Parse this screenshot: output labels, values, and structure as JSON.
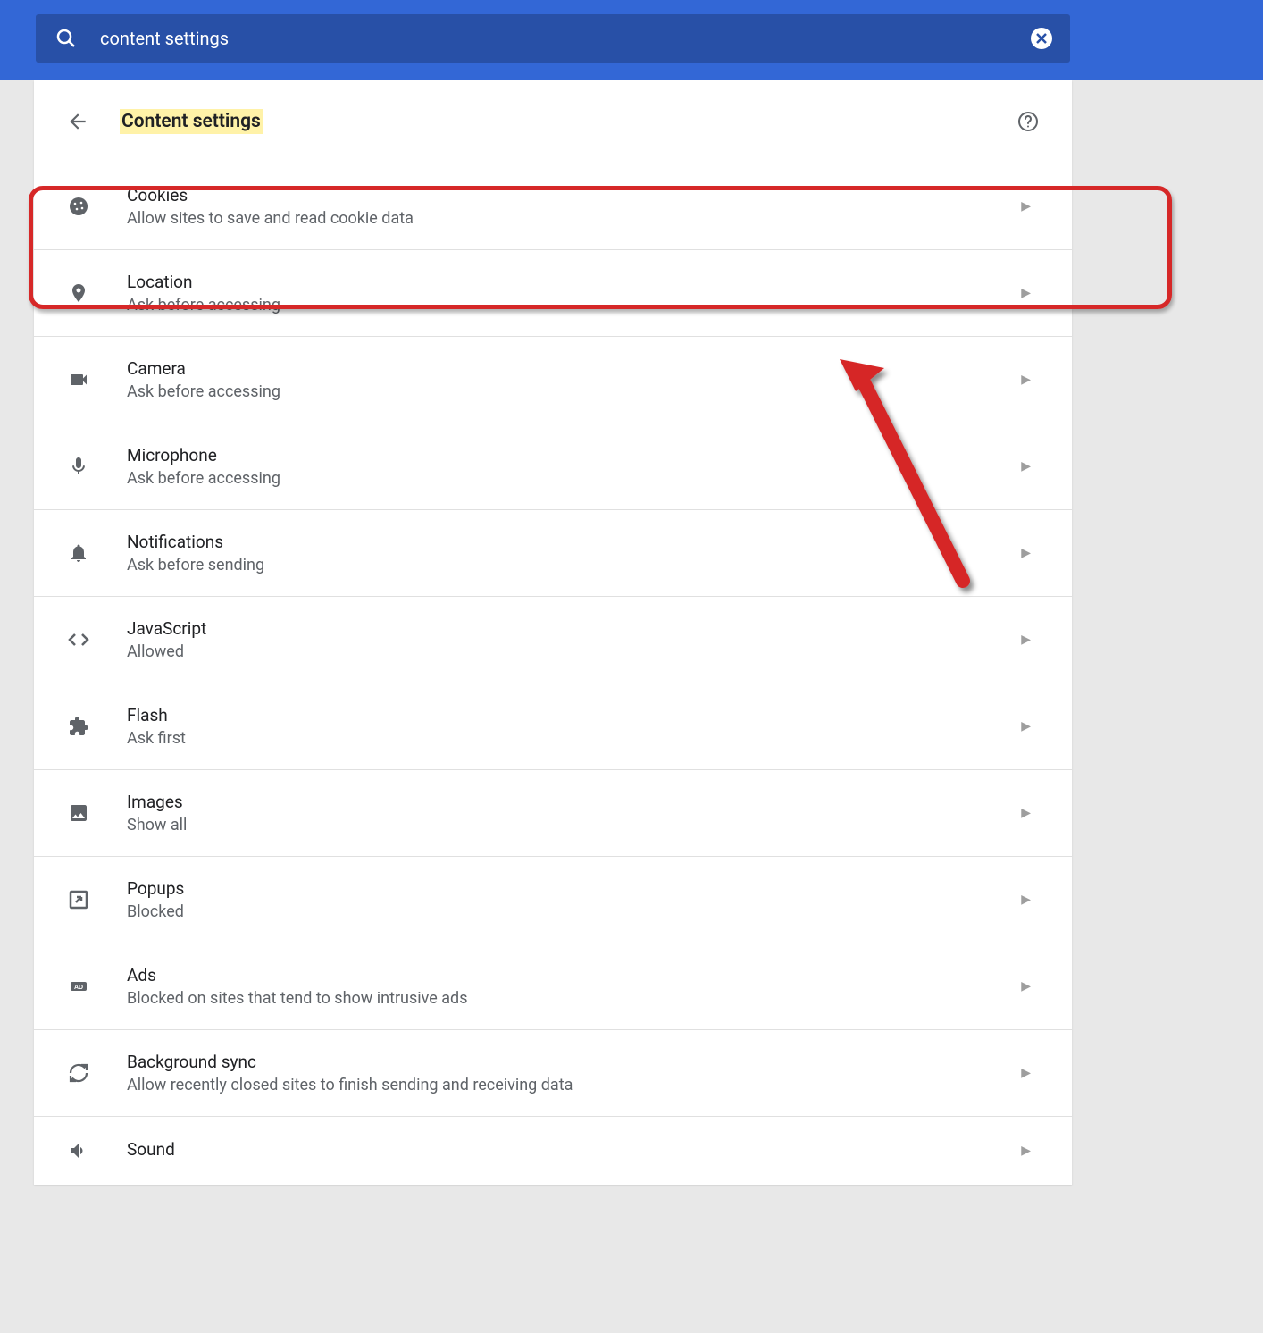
{
  "search": {
    "text": "content settings"
  },
  "header": {
    "title": "Content settings"
  },
  "rows": [
    {
      "icon": "cookie",
      "title": "Cookies",
      "sub": "Allow sites to save and read cookie data"
    },
    {
      "icon": "location",
      "title": "Location",
      "sub": "Ask before accessing"
    },
    {
      "icon": "camera",
      "title": "Camera",
      "sub": "Ask before accessing"
    },
    {
      "icon": "microphone",
      "title": "Microphone",
      "sub": "Ask before accessing"
    },
    {
      "icon": "notifications",
      "title": "Notifications",
      "sub": "Ask before sending"
    },
    {
      "icon": "javascript",
      "title": "JavaScript",
      "sub": "Allowed"
    },
    {
      "icon": "flash",
      "title": "Flash",
      "sub": "Ask first"
    },
    {
      "icon": "images",
      "title": "Images",
      "sub": "Show all"
    },
    {
      "icon": "popups",
      "title": "Popups",
      "sub": "Blocked"
    },
    {
      "icon": "ads",
      "title": "Ads",
      "sub": "Blocked on sites that tend to show intrusive ads"
    },
    {
      "icon": "sync",
      "title": "Background sync",
      "sub": "Allow recently closed sites to finish sending and receiving data"
    },
    {
      "icon": "sound",
      "title": "Sound",
      "sub": ""
    }
  ]
}
